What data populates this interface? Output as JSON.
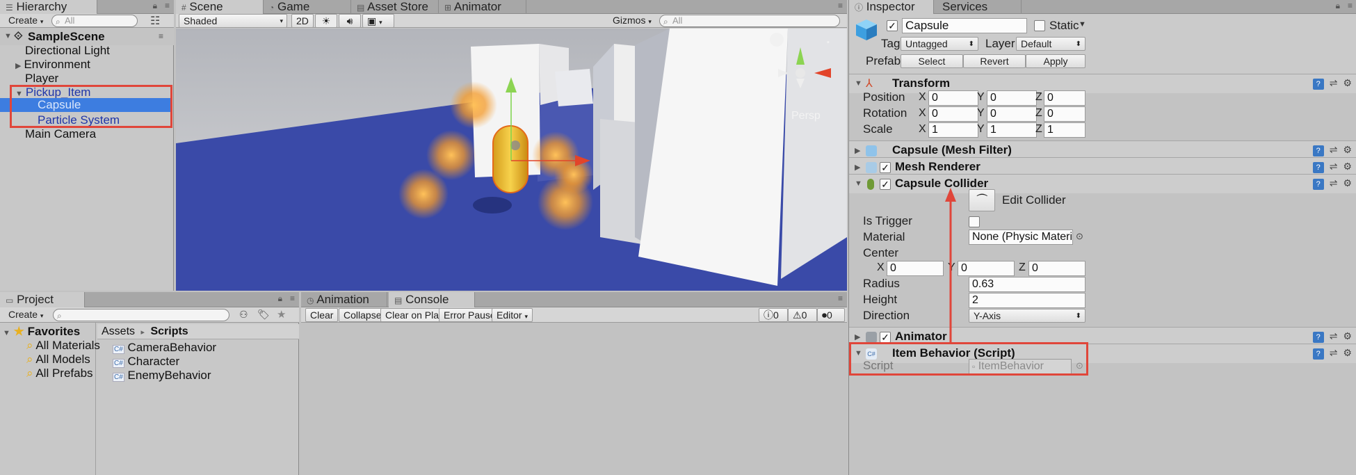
{
  "hierarchy": {
    "tab_label": "Hierarchy",
    "create_label": "Create",
    "search_placeholder": "All",
    "scene_name": "SampleScene",
    "items": [
      {
        "label": "Directional Light"
      },
      {
        "label": "Environment"
      },
      {
        "label": "Player"
      },
      {
        "label": "Pickup_Item"
      },
      {
        "label": "Capsule"
      },
      {
        "label": "Particle System"
      },
      {
        "label": "Main Camera"
      }
    ]
  },
  "scene_tabs": [
    {
      "label": "Scene"
    },
    {
      "label": "Game"
    },
    {
      "label": "Asset Store"
    },
    {
      "label": "Animator"
    }
  ],
  "scene_toolbar": {
    "shading": "Shaded",
    "mode_2d": "2D",
    "gizmos": "Gizmos",
    "search_placeholder": "All"
  },
  "scene_view": {
    "persp_label": "Persp"
  },
  "project": {
    "tab_label": "Project",
    "create_label": "Create",
    "favorites_label": "Favorites",
    "favorites": [
      {
        "label": "All Materials"
      },
      {
        "label": "All Models"
      },
      {
        "label": "All Prefabs"
      }
    ],
    "breadcrumb_root": "Assets",
    "breadcrumb_sep": "▸",
    "breadcrumb_current": "Scripts",
    "files": [
      {
        "label": "CameraBehavior"
      },
      {
        "label": "Character"
      },
      {
        "label": "EnemyBehavior"
      }
    ]
  },
  "console": {
    "tabs": [
      {
        "label": "Animation"
      },
      {
        "label": "Console"
      }
    ],
    "buttons": {
      "clear": "Clear",
      "collapse": "Collapse",
      "clear_on_play": "Clear on Play",
      "error_pause": "Error Pause",
      "editor": "Editor"
    },
    "counts": {
      "logs": "0",
      "warnings": "0",
      "errors": "0"
    }
  },
  "inspector": {
    "tabs": [
      {
        "label": "Inspector"
      },
      {
        "label": "Services"
      }
    ],
    "object_name": "Capsule",
    "static_label": "Static",
    "tag_label": "Tag",
    "tag_value": "Untagged",
    "layer_label": "Layer",
    "layer_value": "Default",
    "prefab_label": "Prefab",
    "prefab_buttons": {
      "select": "Select",
      "revert": "Revert",
      "apply": "Apply"
    },
    "transform": {
      "title": "Transform",
      "position_label": "Position",
      "rotation_label": "Rotation",
      "scale_label": "Scale",
      "position": {
        "x": "0",
        "y": "0",
        "z": "0"
      },
      "rotation": {
        "x": "0",
        "y": "0",
        "z": "0"
      },
      "scale": {
        "x": "1",
        "y": "1",
        "z": "1"
      }
    },
    "mesh_filter_title": "Capsule (Mesh Filter)",
    "mesh_renderer_title": "Mesh Renderer",
    "capsule_collider": {
      "title": "Capsule Collider",
      "edit_collider_label": "Edit Collider",
      "is_trigger_label": "Is Trigger",
      "material_label": "Material",
      "material_value": "None (Physic Material)",
      "center_label": "Center",
      "center": {
        "x": "0",
        "y": "0",
        "z": "0"
      },
      "radius_label": "Radius",
      "radius_value": "0.63",
      "height_label": "Height",
      "height_value": "2",
      "direction_label": "Direction",
      "direction_value": "Y-Axis"
    },
    "animator_title": "Animator",
    "item_behavior": {
      "title": "Item Behavior (Script)",
      "script_label": "Script",
      "script_value": "ItemBehavior"
    },
    "axis_x": "X",
    "axis_y": "Y",
    "axis_z": "Z"
  },
  "colors": {
    "accent_selection": "#3d7de0",
    "annotation_red": "#e0463a",
    "floor_blue": "#3a4aa8",
    "particle_orange": "#f49a2a"
  }
}
